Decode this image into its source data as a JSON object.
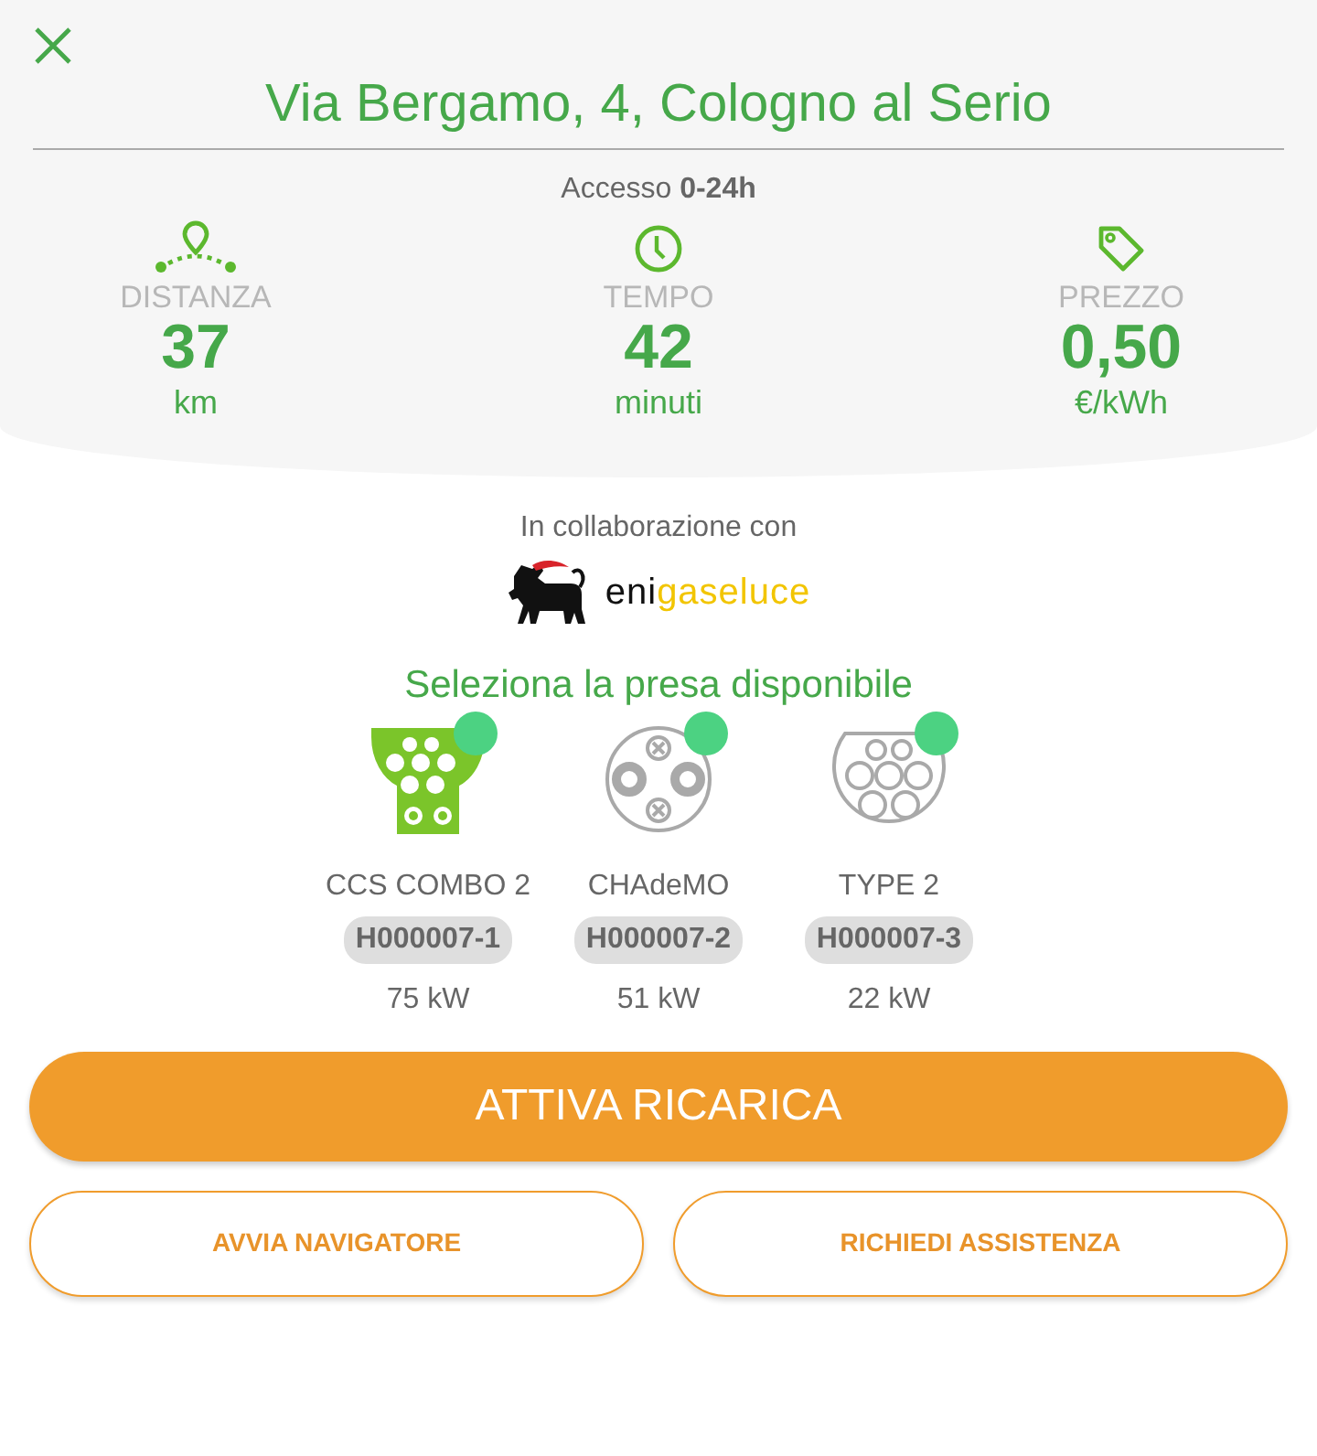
{
  "header": {
    "title": "Via Bergamo, 4, Cologno al Serio",
    "access": "Accesso **0-24h**"
  },
  "stats": [
    {
      "kind": "distance",
      "label": "DISTANZA",
      "value": "37",
      "unit": "km"
    },
    {
      "kind": "time",
      "label": "TEMPO",
      "value": "42",
      "unit": "minuti"
    },
    {
      "kind": "price",
      "label": "PREZZO",
      "value": "0,50",
      "unit": "€/kWh"
    }
  ],
  "partner": {
    "caption": "In collaborazione con",
    "brand_dark": "eni",
    "brand_accent": "gaseluce"
  },
  "connectors_title": "Seleziona la presa disponibile",
  "connectors": [
    {
      "kind": "ccs",
      "name": "CCS COMBO 2",
      "code": "H000007-1",
      "power": "75 kW",
      "selected": true,
      "color": "#4cd282"
    },
    {
      "kind": "chademo",
      "name": "CHAdeMO",
      "code": "H000007-2",
      "power": "51 kW",
      "selected": false,
      "color": "#4cd282"
    },
    {
      "kind": "type2",
      "name": "TYPE 2",
      "code": "H000007-3",
      "power": "22 kW",
      "selected": false,
      "color": "#4cd282"
    }
  ],
  "primary_button": "ATTIVA RICARICA",
  "secondary_buttons": [
    "AVVIA NAVIGATORE",
    "RICHIEDI ASSISTENZA"
  ]
}
